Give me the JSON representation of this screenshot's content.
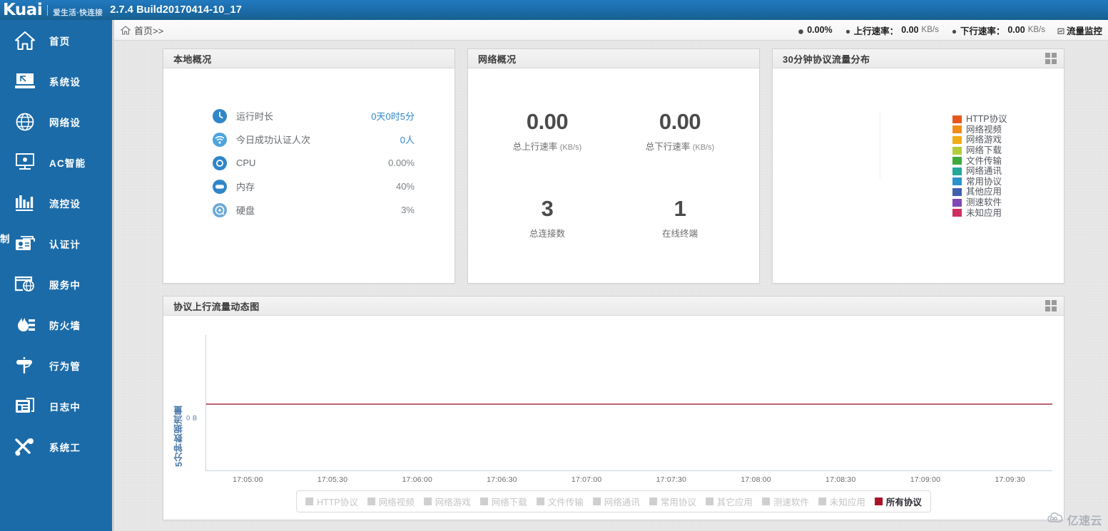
{
  "header": {
    "logo_text": "Kuai",
    "logo_tagline": "爱生活·快连接",
    "build_version": "2.7.4 Build20170414-10_17"
  },
  "breadcrumb": {
    "home_icon": "home-icon",
    "text": "首页>>"
  },
  "statusbar": {
    "items": [
      {
        "icon": "cpu-dot-icon",
        "label": "",
        "value": "0.00%",
        "unit": ""
      },
      {
        "icon": "upload-dot-icon",
        "label": "上行速率：",
        "value": "0.00",
        "unit": "KB/s"
      },
      {
        "icon": "download-dot-icon",
        "label": "下行速率：",
        "value": "0.00",
        "unit": "KB/s"
      },
      {
        "icon": "monitor-icon",
        "label": "",
        "value": "流量监控",
        "unit": ""
      }
    ]
  },
  "sidebar": {
    "partial_label": "制",
    "items": [
      {
        "label": "首页",
        "icon": "home-icon"
      },
      {
        "label": "系统设",
        "icon": "system-settings-icon"
      },
      {
        "label": "网络设",
        "icon": "globe-network-icon"
      },
      {
        "label": "AC智能",
        "icon": "ac-monitor-icon"
      },
      {
        "label": "流控设",
        "icon": "bar-chart-icon"
      },
      {
        "label": "认证计",
        "icon": "id-card-icon"
      },
      {
        "label": "服务中",
        "icon": "server-globe-icon"
      },
      {
        "label": "防火墙",
        "icon": "firewall-flame-icon"
      },
      {
        "label": "行为管",
        "icon": "behavior-control-icon"
      },
      {
        "label": "日志中",
        "icon": "log-archive-icon"
      },
      {
        "label": "系统工",
        "icon": "tools-wrench-icon"
      }
    ]
  },
  "panels": {
    "local": {
      "title": "本地概况",
      "rows": [
        {
          "icon": "clock-icon",
          "name": "运行时长",
          "value": "0天0时5分",
          "accent": true
        },
        {
          "icon": "wifi-icon",
          "name": "今日成功认证人次",
          "value": "0人",
          "accent": true
        },
        {
          "icon": "cpu-icon",
          "name": "CPU",
          "value": "0.00%",
          "accent": false
        },
        {
          "icon": "memory-icon",
          "name": "内存",
          "value": "40%",
          "accent": false
        },
        {
          "icon": "disk-icon",
          "name": "硬盘",
          "value": "3%",
          "accent": false
        }
      ]
    },
    "network": {
      "title": "网络概况",
      "cells": [
        {
          "value": "0.00",
          "label": "总上行速率",
          "unit": "(KB/s)"
        },
        {
          "value": "0.00",
          "label": "总下行速率",
          "unit": "(KB/s)"
        },
        {
          "value": "3",
          "label": "总连接数",
          "unit": ""
        },
        {
          "value": "1",
          "label": "在线终端",
          "unit": ""
        }
      ]
    },
    "pie": {
      "title": "30分钟协议流量分布",
      "grid_icon": "grid-icon"
    },
    "flow": {
      "title": "协议上行流量动态图",
      "grid_icon": "grid-icon"
    }
  },
  "chart_data": [
    {
      "type": "pie",
      "title": "30分钟协议流量分布",
      "legend_position": "right",
      "labels": [
        "HTTP协议",
        "网络视频",
        "网络游戏",
        "网络下载",
        "文件传输",
        "网络通讯",
        "常用协议",
        "其他应用",
        "测速软件",
        "未知应用"
      ],
      "colors": [
        "#e8561f",
        "#f08c1a",
        "#f2ac18",
        "#b2cc3a",
        "#3fa93c",
        "#23a89a",
        "#2b93cc",
        "#4160b0",
        "#8148b5",
        "#cf2f5e"
      ],
      "values": [
        0,
        0,
        0,
        0,
        0,
        0,
        0,
        0,
        0,
        0
      ],
      "note": "no data rendered — empty pie"
    },
    {
      "type": "line",
      "title": "协议上行流量动态图",
      "xlabel": "",
      "ylabel": "5分钟数据流量",
      "x": [
        "17:05:00",
        "17:05:30",
        "17:06:00",
        "17:06:30",
        "17:07:00",
        "17:07:30",
        "17:08:00",
        "17:08:30",
        "17:09:00",
        "17:09:30"
      ],
      "ytick_labels": [
        "0 B"
      ],
      "ylim": [
        0,
        0
      ],
      "grid": false,
      "legend_position": "bottom",
      "series": [
        {
          "name": "HTTP协议",
          "color": "#cfcfcf",
          "active": false,
          "values": [
            null,
            null,
            null,
            null,
            null,
            null,
            null,
            null,
            null,
            null
          ]
        },
        {
          "name": "网络视频",
          "color": "#cfcfcf",
          "active": false,
          "values": [
            null,
            null,
            null,
            null,
            null,
            null,
            null,
            null,
            null,
            null
          ]
        },
        {
          "name": "网络游戏",
          "color": "#cfcfcf",
          "active": false,
          "values": [
            null,
            null,
            null,
            null,
            null,
            null,
            null,
            null,
            null,
            null
          ]
        },
        {
          "name": "网络下载",
          "color": "#cfcfcf",
          "active": false,
          "values": [
            null,
            null,
            null,
            null,
            null,
            null,
            null,
            null,
            null,
            null
          ]
        },
        {
          "name": "文件传输",
          "color": "#cfcfcf",
          "active": false,
          "values": [
            null,
            null,
            null,
            null,
            null,
            null,
            null,
            null,
            null,
            null
          ]
        },
        {
          "name": "网络通讯",
          "color": "#cfcfcf",
          "active": false,
          "values": [
            null,
            null,
            null,
            null,
            null,
            null,
            null,
            null,
            null,
            null
          ]
        },
        {
          "name": "常用协议",
          "color": "#cfcfcf",
          "active": false,
          "values": [
            null,
            null,
            null,
            null,
            null,
            null,
            null,
            null,
            null,
            null
          ]
        },
        {
          "name": "其它应用",
          "color": "#cfcfcf",
          "active": false,
          "values": [
            null,
            null,
            null,
            null,
            null,
            null,
            null,
            null,
            null,
            null
          ]
        },
        {
          "name": "测速软件",
          "color": "#cfcfcf",
          "active": false,
          "values": [
            null,
            null,
            null,
            null,
            null,
            null,
            null,
            null,
            null,
            null
          ]
        },
        {
          "name": "未知应用",
          "color": "#cfcfcf",
          "active": false,
          "values": [
            null,
            null,
            null,
            null,
            null,
            null,
            null,
            null,
            null,
            null
          ]
        },
        {
          "name": "所有协议",
          "color": "#a8132a",
          "active": true,
          "values": [
            0,
            0,
            0,
            0,
            0,
            0,
            0,
            0,
            0,
            0
          ]
        }
      ]
    }
  ],
  "watermark": {
    "text": "亿速云",
    "icon": "cloud-icon"
  },
  "colors": {
    "brand_blue": "#1b6ba8",
    "accent_blue": "#2f86c8",
    "line_red": "#a8132a",
    "panel_border": "#d2d2d2"
  }
}
